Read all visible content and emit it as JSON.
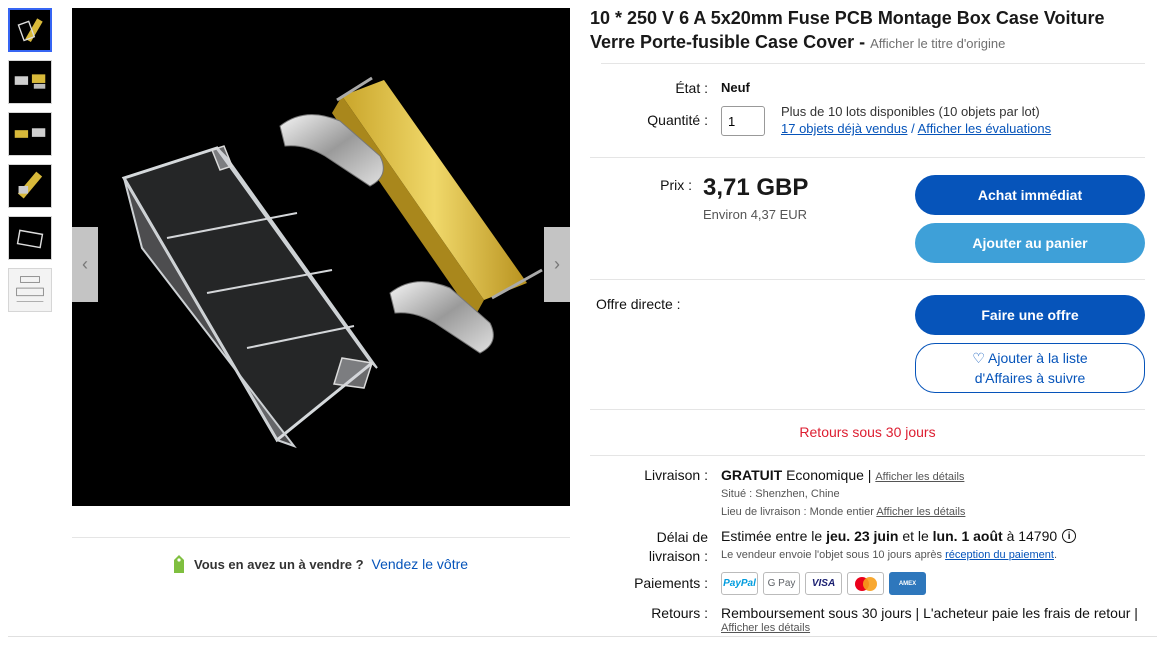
{
  "title": {
    "text": "10 * 250 V 6 A 5x20mm Fuse PCB Montage Box Case Voiture Verre Porte-fusible Case Cover -",
    "original_link": "Afficher le titre d'origine"
  },
  "condition": {
    "label": "État :",
    "value": "Neuf"
  },
  "quantity": {
    "label": "Quantité :",
    "value": "1",
    "availability": "Plus de 10 lots disponibles (10 objets par lot)",
    "sold_link": "17 objets déjà vendus",
    "separator": "/",
    "reviews_link": "Afficher les évaluations"
  },
  "price": {
    "label": "Prix :",
    "value": "3,71 GBP",
    "approx_prefix": "Environ",
    "approx_value": "4,37 EUR"
  },
  "buttons": {
    "buy_now": "Achat immédiat",
    "add_to_cart": "Ajouter au panier",
    "make_offer": "Faire une offre",
    "watch_line1": "♡ Ajouter à la liste",
    "watch_line2": "d'Affaires à suivre"
  },
  "best_offer": {
    "label": "Offre directe :"
  },
  "returns_banner": "Retours sous 30 jours",
  "shipping": {
    "label": "Livraison :",
    "free": "GRATUIT",
    "method": "Economique |",
    "details_link": "Afficher les détails",
    "location": "Situé : Shenzhen, Chine",
    "ships_to_prefix": "Lieu de livraison : Monde entier",
    "ships_to_link": "Afficher les détails"
  },
  "delivery": {
    "label_line1": "Délai de",
    "label_line2": "livraison :",
    "est_prefix": "Estimée entre le",
    "date1": "jeu. 23 juin",
    "mid": "et le",
    "date2": "lun. 1 août",
    "suffix": "à 14790",
    "note_prefix": "Le vendeur envoie l'objet sous 10 jours après",
    "note_link": "réception du paiement",
    "note_end": "."
  },
  "payments": {
    "label": "Paiements :",
    "methods": [
      "PayPal",
      "G Pay",
      "VISA",
      "Mastercard",
      "AMEX"
    ]
  },
  "returns": {
    "label": "Retours :",
    "text": "Remboursement sous 30 jours | L'acheteur paie les frais de retour |",
    "details_link": "Afficher les détails"
  },
  "sell": {
    "text": "Vous en avez un à vendre ?",
    "link": "Vendez le vôtre"
  },
  "colors": {
    "primary_blue": "#0654ba",
    "secondary_blue": "#3ea0d8",
    "returns_red": "#dd1e31",
    "thumb_active_border": "#3665f3"
  }
}
